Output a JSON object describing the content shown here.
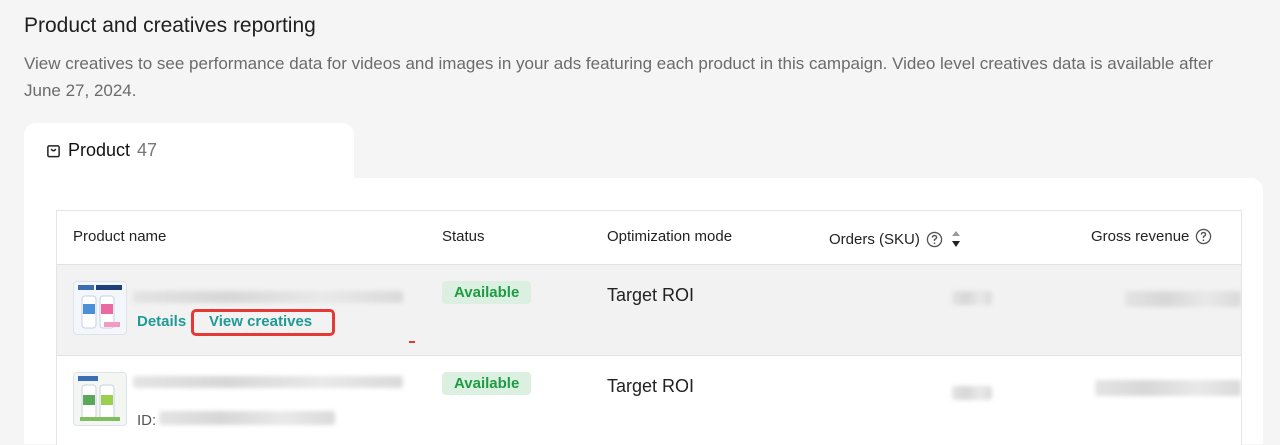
{
  "section": {
    "title": "Product and creatives reporting",
    "description": "View creatives to see performance data for videos and images in your ads featuring each product in this campaign. Video level creatives data is available after June 27, 2024."
  },
  "tab": {
    "icon": "shopping-bag-icon",
    "label": "Product",
    "count": "47"
  },
  "table": {
    "columns": [
      {
        "label": "Product name"
      },
      {
        "label": "Status"
      },
      {
        "label": "Optimization mode"
      },
      {
        "label": "Orders (SKU)",
        "icons": [
          "help-icon",
          "sort-icon"
        ]
      },
      {
        "label": "Gross revenue",
        "icons": [
          "help-icon"
        ]
      }
    ],
    "rows": [
      {
        "actions": {
          "details": "Details",
          "view_creatives": "View creatives"
        },
        "status": "Available",
        "optimization_mode": "Target ROI"
      },
      {
        "id_label": "ID:",
        "status": "Available",
        "optimization_mode": "Target ROI"
      }
    ]
  },
  "colors": {
    "link": "#1f9a96",
    "badge_bg": "#dcf0e1",
    "badge_text": "#1e9b43",
    "highlight": "#e53935"
  }
}
